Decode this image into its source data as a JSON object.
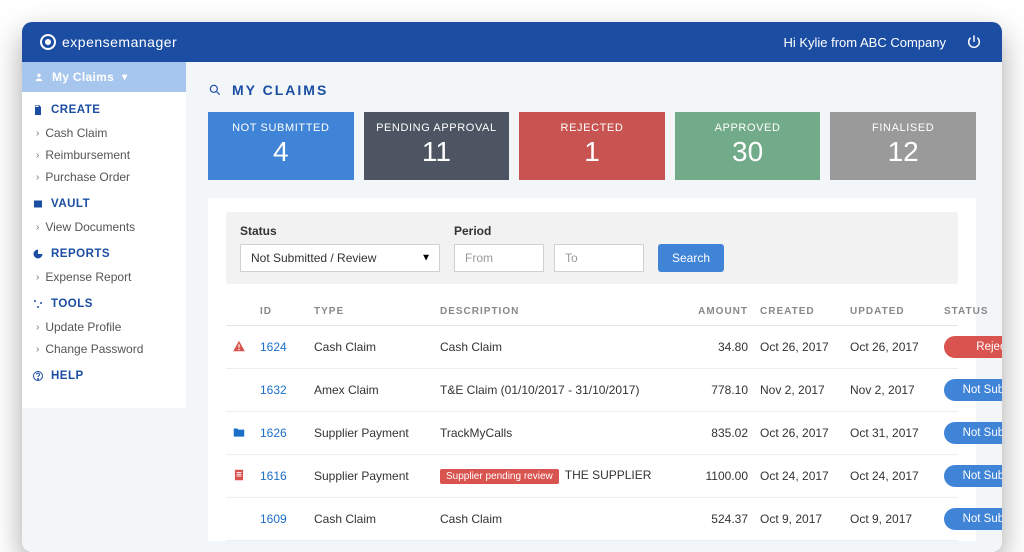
{
  "brand": {
    "name": "expensemanager"
  },
  "greeting": "Hi Kylie from ABC Company",
  "sidebar": {
    "active": "My Claims",
    "sections": [
      {
        "label": "CREATE",
        "icon": "doc",
        "items": [
          "Cash Claim",
          "Reimbursement",
          "Purchase Order"
        ]
      },
      {
        "label": "VAULT",
        "icon": "vault",
        "items": [
          "View Documents"
        ]
      },
      {
        "label": "REPORTS",
        "icon": "pie",
        "items": [
          "Expense Report"
        ]
      },
      {
        "label": "TOOLS",
        "icon": "tools",
        "items": [
          "Update Profile",
          "Change Password"
        ]
      },
      {
        "label": "HELP",
        "icon": "help",
        "items": []
      }
    ]
  },
  "page": {
    "title": "MY CLAIMS"
  },
  "tiles": [
    {
      "label": "NOT SUBMITTED",
      "value": "4",
      "tone": "blue"
    },
    {
      "label": "PENDING APPROVAL",
      "value": "11",
      "tone": "dark"
    },
    {
      "label": "REJECTED",
      "value": "1",
      "tone": "red"
    },
    {
      "label": "APPROVED",
      "value": "30",
      "tone": "green"
    },
    {
      "label": "FINALISED",
      "value": "12",
      "tone": "gray"
    }
  ],
  "filters": {
    "status_label": "Status",
    "status_value": "Not Submitted / Review",
    "period_label": "Period",
    "from_placeholder": "From",
    "to_placeholder": "To",
    "search_label": "Search"
  },
  "table": {
    "columns": [
      "",
      "ID",
      "TYPE",
      "DESCRIPTION",
      "AMOUNT",
      "CREATED",
      "UPDATED",
      "STATUS"
    ],
    "rows": [
      {
        "icon": "alert",
        "id": "1624",
        "type": "Cash Claim",
        "description": "Cash Claim",
        "chip": "",
        "amount": "34.80",
        "created": "Oct 26, 2017",
        "updated": "Oct 26, 2017",
        "status": "Rejected",
        "status_tone": "red"
      },
      {
        "icon": "",
        "id": "1632",
        "type": "Amex Claim",
        "description": "T&E Claim (01/10/2017 - 31/10/2017)",
        "chip": "",
        "amount": "778.10",
        "created": "Nov 2, 2017",
        "updated": "Nov 2, 2017",
        "status": "Not Submitted",
        "status_tone": "blue"
      },
      {
        "icon": "folder",
        "id": "1626",
        "type": "Supplier Payment",
        "description": "TrackMyCalls",
        "chip": "",
        "amount": "835.02",
        "created": "Oct 26, 2017",
        "updated": "Oct 31, 2017",
        "status": "Not Submitted",
        "status_tone": "blue"
      },
      {
        "icon": "invoice",
        "id": "1616",
        "type": "Supplier Payment",
        "description": "THE SUPPLIER",
        "chip": "Supplier pending review",
        "amount": "1100.00",
        "created": "Oct 24, 2017",
        "updated": "Oct 24, 2017",
        "status": "Not Submitted",
        "status_tone": "blue"
      },
      {
        "icon": "",
        "id": "1609",
        "type": "Cash Claim",
        "description": "Cash Claim",
        "chip": "",
        "amount": "524.37",
        "created": "Oct 9, 2017",
        "updated": "Oct 9, 2017",
        "status": "Not Submitted",
        "status_tone": "blue"
      }
    ]
  }
}
